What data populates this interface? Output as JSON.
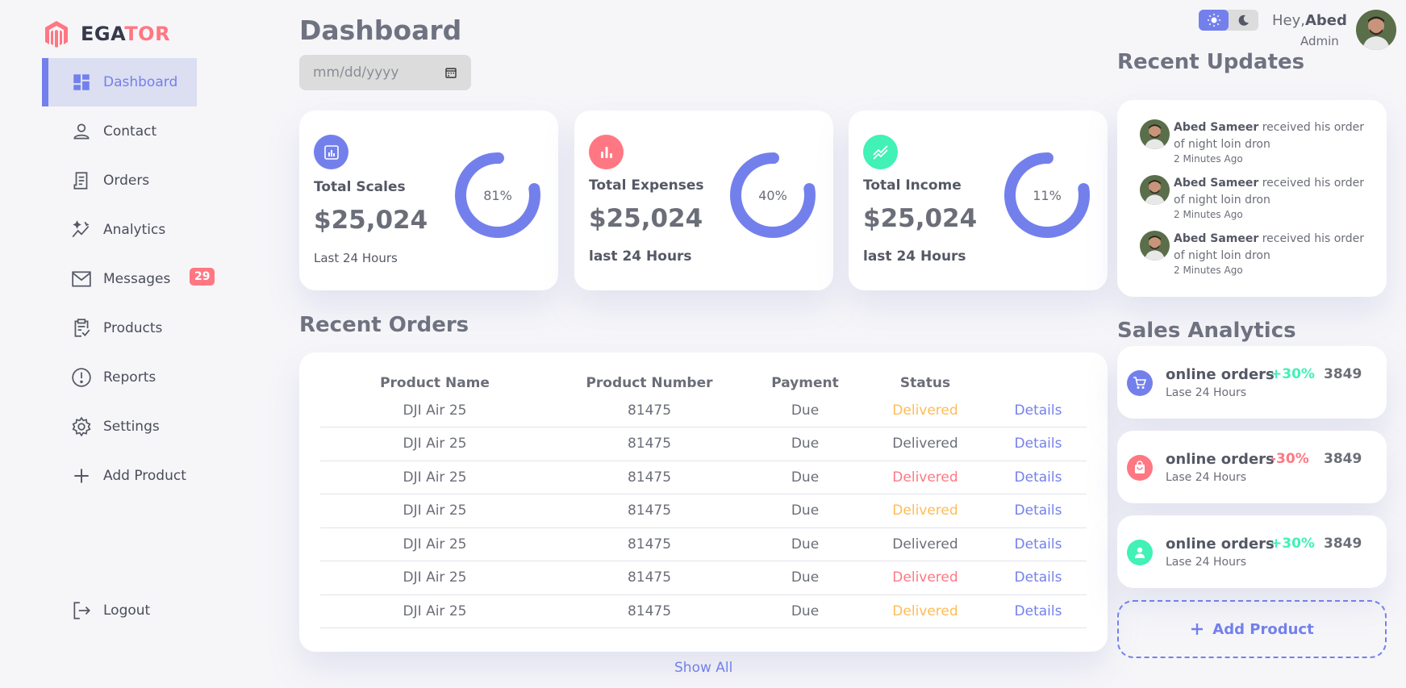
{
  "brand": {
    "name_part1": "EGA",
    "name_part2": "TOR"
  },
  "sidebar": {
    "items": [
      {
        "label": "Dashboard",
        "icon": "grid-icon",
        "active": true
      },
      {
        "label": "Contact",
        "icon": "person-icon"
      },
      {
        "label": "Orders",
        "icon": "receipt-icon"
      },
      {
        "label": "Analytics",
        "icon": "insights-icon"
      },
      {
        "label": "Messages",
        "icon": "mail-icon",
        "badge": "29"
      },
      {
        "label": "Products",
        "icon": "clipboard-check-icon"
      },
      {
        "label": "Reports",
        "icon": "alert-circle-icon"
      },
      {
        "label": "Settings",
        "icon": "gear-icon"
      },
      {
        "label": "Add Product",
        "icon": "plus-icon"
      }
    ],
    "logout": {
      "label": "Logout",
      "icon": "logout-icon"
    }
  },
  "header": {
    "title": "Dashboard",
    "date_placeholder": "mm/dd/yyyy"
  },
  "kpis": [
    {
      "title": "Total Scales",
      "value": "$25,024",
      "sub": "Last 24 Hours",
      "percent_label": "81%",
      "percent": 81,
      "icon": "analytics-icon",
      "color": "#7380ec"
    },
    {
      "title": "Total Expenses",
      "value": "$25,024",
      "sub": "last 24 Hours",
      "percent_label": "40%",
      "percent": 40,
      "icon": "bar-chart-icon",
      "color": "#ff7782"
    },
    {
      "title": "Total Income",
      "value": "$25,024",
      "sub": "last 24 Hours",
      "percent_label": "11%",
      "percent": 11,
      "icon": "trending-icon",
      "color": "#41f1b6"
    }
  ],
  "recent_orders": {
    "title": "Recent Orders",
    "columns": [
      "Product Name",
      "Product Number",
      "Payment",
      "Status"
    ],
    "rows": [
      {
        "name": "DJI Air 25",
        "number": "81475",
        "payment": "Due",
        "status": "Delivered",
        "status_color": "#ffbb55",
        "action": "Details"
      },
      {
        "name": "DJI Air 25",
        "number": "81475",
        "payment": "Due",
        "status": "Delivered",
        "status_color": "#6b6e78",
        "action": "Details"
      },
      {
        "name": "DJI Air 25",
        "number": "81475",
        "payment": "Due",
        "status": "Delivered",
        "status_color": "#ff7782",
        "action": "Details"
      },
      {
        "name": "DJI Air 25",
        "number": "81475",
        "payment": "Due",
        "status": "Delivered",
        "status_color": "#ffbb55",
        "action": "Details"
      },
      {
        "name": "DJI Air 25",
        "number": "81475",
        "payment": "Due",
        "status": "Delivered",
        "status_color": "#6b6e78",
        "action": "Details"
      },
      {
        "name": "DJI Air 25",
        "number": "81475",
        "payment": "Due",
        "status": "Delivered",
        "status_color": "#ff7782",
        "action": "Details"
      },
      {
        "name": "DJI Air 25",
        "number": "81475",
        "payment": "Due",
        "status": "Delivered",
        "status_color": "#ffbb55",
        "action": "Details"
      }
    ],
    "show_all": "Show All"
  },
  "profile": {
    "greeting": "Hey,",
    "name": "Abed",
    "role": "Admin"
  },
  "recent_updates": {
    "title": "Recent Updates",
    "items": [
      {
        "name": "Abed Sameer",
        "text": " received his order of night loin dron",
        "time": "2 Minutes Ago"
      },
      {
        "name": "Abed Sameer",
        "text": " received his order of night loin dron",
        "time": "2 Minutes Ago"
      },
      {
        "name": "Abed Sameer",
        "text": " received his order of night loin dron",
        "time": "2 Minutes Ago"
      }
    ]
  },
  "sales_analytics": {
    "title": "Sales Analytics",
    "items": [
      {
        "title": "online orders",
        "sub": "Lase 24 Hours",
        "pct": "+30%",
        "pct_color": "#41f1b6",
        "num": "3849",
        "icon": "cart-icon",
        "color": "#7380ec"
      },
      {
        "title": "online orders",
        "sub": "Lase 24 Hours",
        "pct": "-30%",
        "pct_color": "#ff7782",
        "num": "3849",
        "icon": "shopping-bag-icon",
        "color": "#ff7782"
      },
      {
        "title": "online orders",
        "sub": "Lase 24 Hours",
        "pct": "+30%",
        "pct_color": "#41f1b6",
        "num": "3849",
        "icon": "person-icon",
        "color": "#41f1b6"
      }
    ],
    "add_product": "Add Product"
  },
  "colors": {
    "primary": "#7380ec",
    "danger": "#ff7782",
    "success": "#41f1b6",
    "warning": "#ffbb55"
  }
}
